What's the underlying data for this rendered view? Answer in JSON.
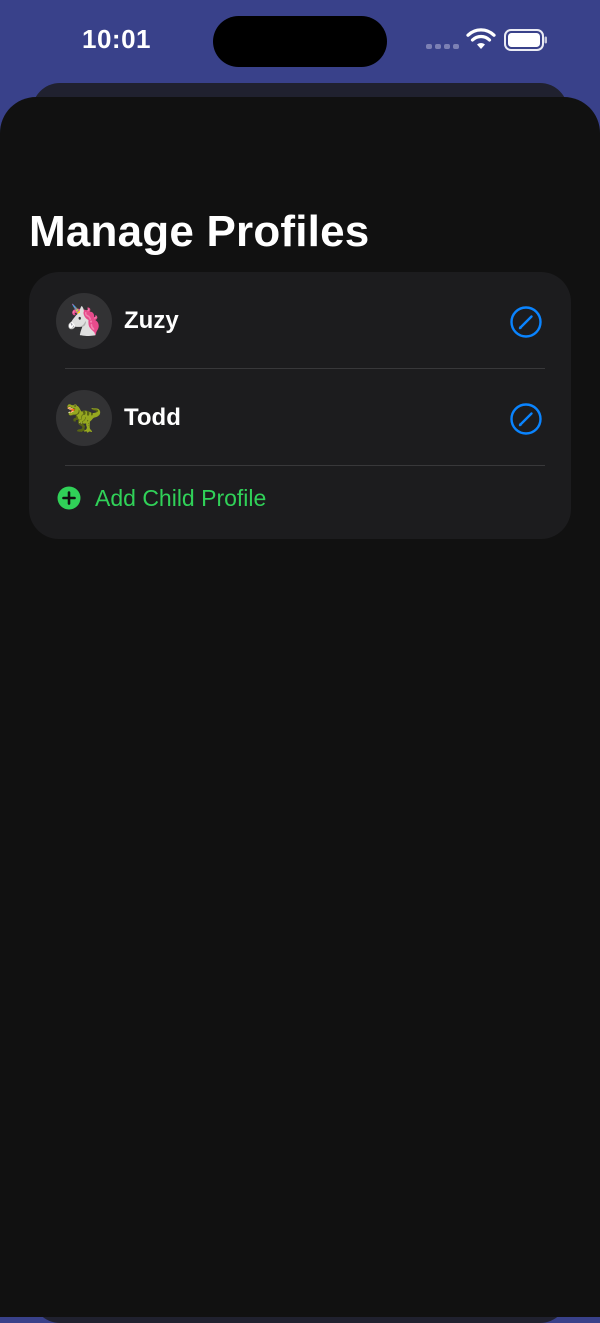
{
  "status_bar": {
    "time": "10:01"
  },
  "page": {
    "title": "Manage Profiles"
  },
  "profiles": [
    {
      "name": "Zuzy",
      "avatar_emoji": "🦄",
      "icon": "unicorn-icon"
    },
    {
      "name": "Todd",
      "avatar_emoji": "🦖",
      "icon": "t-rex-icon"
    }
  ],
  "add_profile": {
    "label": "Add Child Profile"
  },
  "colors": {
    "status_bar_background": "#39418a",
    "sheet_background": "#111111",
    "card_background": "#1c1c1e",
    "edit_accent": "#0a84ff",
    "add_accent": "#30d158"
  }
}
